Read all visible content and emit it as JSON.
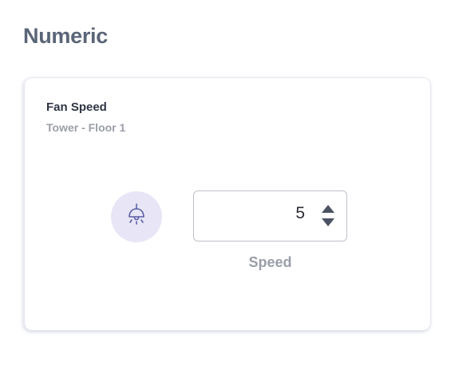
{
  "section": {
    "title": "Numeric"
  },
  "card": {
    "title": "Fan Speed",
    "subtitle": "Tower - Floor 1",
    "icon": "ceiling-lamp-icon",
    "accent_color": "#e8e6f6",
    "icon_color": "#5b5ea6",
    "stepper": {
      "value": "5",
      "label": "Speed"
    }
  }
}
